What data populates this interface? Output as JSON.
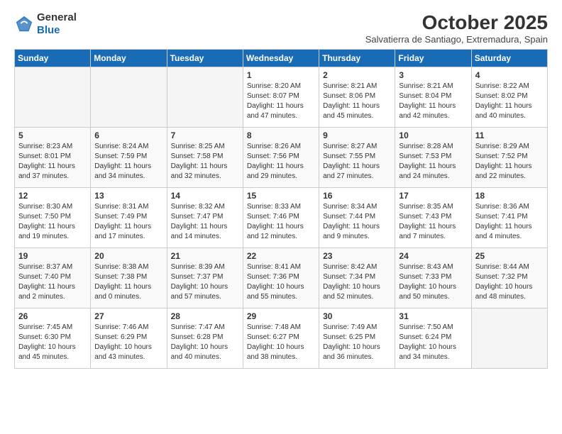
{
  "logo": {
    "general": "General",
    "blue": "Blue"
  },
  "title": "October 2025",
  "location": "Salvatierra de Santiago, Extremadura, Spain",
  "days_of_week": [
    "Sunday",
    "Monday",
    "Tuesday",
    "Wednesday",
    "Thursday",
    "Friday",
    "Saturday"
  ],
  "weeks": [
    [
      {
        "day": "",
        "info": ""
      },
      {
        "day": "",
        "info": ""
      },
      {
        "day": "",
        "info": ""
      },
      {
        "day": "1",
        "info": "Sunrise: 8:20 AM\nSunset: 8:07 PM\nDaylight: 11 hours\nand 47 minutes."
      },
      {
        "day": "2",
        "info": "Sunrise: 8:21 AM\nSunset: 8:06 PM\nDaylight: 11 hours\nand 45 minutes."
      },
      {
        "day": "3",
        "info": "Sunrise: 8:21 AM\nSunset: 8:04 PM\nDaylight: 11 hours\nand 42 minutes."
      },
      {
        "day": "4",
        "info": "Sunrise: 8:22 AM\nSunset: 8:02 PM\nDaylight: 11 hours\nand 40 minutes."
      }
    ],
    [
      {
        "day": "5",
        "info": "Sunrise: 8:23 AM\nSunset: 8:01 PM\nDaylight: 11 hours\nand 37 minutes."
      },
      {
        "day": "6",
        "info": "Sunrise: 8:24 AM\nSunset: 7:59 PM\nDaylight: 11 hours\nand 34 minutes."
      },
      {
        "day": "7",
        "info": "Sunrise: 8:25 AM\nSunset: 7:58 PM\nDaylight: 11 hours\nand 32 minutes."
      },
      {
        "day": "8",
        "info": "Sunrise: 8:26 AM\nSunset: 7:56 PM\nDaylight: 11 hours\nand 29 minutes."
      },
      {
        "day": "9",
        "info": "Sunrise: 8:27 AM\nSunset: 7:55 PM\nDaylight: 11 hours\nand 27 minutes."
      },
      {
        "day": "10",
        "info": "Sunrise: 8:28 AM\nSunset: 7:53 PM\nDaylight: 11 hours\nand 24 minutes."
      },
      {
        "day": "11",
        "info": "Sunrise: 8:29 AM\nSunset: 7:52 PM\nDaylight: 11 hours\nand 22 minutes."
      }
    ],
    [
      {
        "day": "12",
        "info": "Sunrise: 8:30 AM\nSunset: 7:50 PM\nDaylight: 11 hours\nand 19 minutes."
      },
      {
        "day": "13",
        "info": "Sunrise: 8:31 AM\nSunset: 7:49 PM\nDaylight: 11 hours\nand 17 minutes."
      },
      {
        "day": "14",
        "info": "Sunrise: 8:32 AM\nSunset: 7:47 PM\nDaylight: 11 hours\nand 14 minutes."
      },
      {
        "day": "15",
        "info": "Sunrise: 8:33 AM\nSunset: 7:46 PM\nDaylight: 11 hours\nand 12 minutes."
      },
      {
        "day": "16",
        "info": "Sunrise: 8:34 AM\nSunset: 7:44 PM\nDaylight: 11 hours\nand 9 minutes."
      },
      {
        "day": "17",
        "info": "Sunrise: 8:35 AM\nSunset: 7:43 PM\nDaylight: 11 hours\nand 7 minutes."
      },
      {
        "day": "18",
        "info": "Sunrise: 8:36 AM\nSunset: 7:41 PM\nDaylight: 11 hours\nand 4 minutes."
      }
    ],
    [
      {
        "day": "19",
        "info": "Sunrise: 8:37 AM\nSunset: 7:40 PM\nDaylight: 11 hours\nand 2 minutes."
      },
      {
        "day": "20",
        "info": "Sunrise: 8:38 AM\nSunset: 7:38 PM\nDaylight: 11 hours\nand 0 minutes."
      },
      {
        "day": "21",
        "info": "Sunrise: 8:39 AM\nSunset: 7:37 PM\nDaylight: 10 hours\nand 57 minutes."
      },
      {
        "day": "22",
        "info": "Sunrise: 8:41 AM\nSunset: 7:36 PM\nDaylight: 10 hours\nand 55 minutes."
      },
      {
        "day": "23",
        "info": "Sunrise: 8:42 AM\nSunset: 7:34 PM\nDaylight: 10 hours\nand 52 minutes."
      },
      {
        "day": "24",
        "info": "Sunrise: 8:43 AM\nSunset: 7:33 PM\nDaylight: 10 hours\nand 50 minutes."
      },
      {
        "day": "25",
        "info": "Sunrise: 8:44 AM\nSunset: 7:32 PM\nDaylight: 10 hours\nand 48 minutes."
      }
    ],
    [
      {
        "day": "26",
        "info": "Sunrise: 7:45 AM\nSunset: 6:30 PM\nDaylight: 10 hours\nand 45 minutes."
      },
      {
        "day": "27",
        "info": "Sunrise: 7:46 AM\nSunset: 6:29 PM\nDaylight: 10 hours\nand 43 minutes."
      },
      {
        "day": "28",
        "info": "Sunrise: 7:47 AM\nSunset: 6:28 PM\nDaylight: 10 hours\nand 40 minutes."
      },
      {
        "day": "29",
        "info": "Sunrise: 7:48 AM\nSunset: 6:27 PM\nDaylight: 10 hours\nand 38 minutes."
      },
      {
        "day": "30",
        "info": "Sunrise: 7:49 AM\nSunset: 6:25 PM\nDaylight: 10 hours\nand 36 minutes."
      },
      {
        "day": "31",
        "info": "Sunrise: 7:50 AM\nSunset: 6:24 PM\nDaylight: 10 hours\nand 34 minutes."
      },
      {
        "day": "",
        "info": ""
      }
    ]
  ]
}
